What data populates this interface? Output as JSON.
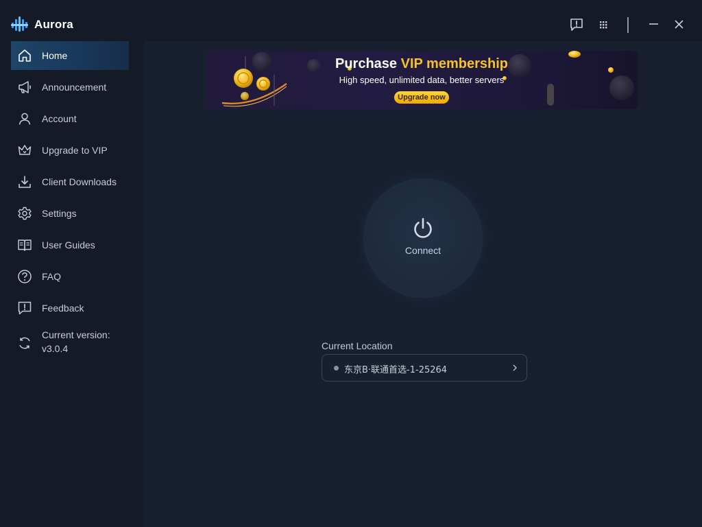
{
  "app": {
    "title": "Aurora"
  },
  "sidebar": {
    "items": [
      {
        "label": "Home",
        "icon": "home-icon",
        "active": true
      },
      {
        "label": "Announcement",
        "icon": "megaphone-icon"
      },
      {
        "label": "Account",
        "icon": "user-icon"
      },
      {
        "label": "Upgrade to VIP",
        "icon": "crown-icon"
      },
      {
        "label": "Client Downloads",
        "icon": "download-icon"
      },
      {
        "label": "Settings",
        "icon": "gear-icon"
      },
      {
        "label": "User Guides",
        "icon": "book-icon"
      },
      {
        "label": "FAQ",
        "icon": "help-icon"
      },
      {
        "label": "Feedback",
        "icon": "feedback-icon"
      }
    ],
    "version": {
      "label": "Current version:",
      "value": "v3.0.4",
      "icon": "refresh-icon"
    }
  },
  "banner": {
    "title_prefix": "Purchase",
    "title_accent": "VIP membership",
    "subtitle": "High speed, unlimited data, better servers",
    "cta": "Upgrade now"
  },
  "connect": {
    "label": "Connect"
  },
  "location": {
    "title": "Current Location",
    "value": "东京B·联通首选-1-25264"
  },
  "colors": {
    "accent": "#f5c12c",
    "active_nav": "#1e4569",
    "background": "#182030",
    "sidebar": "#141b27"
  }
}
